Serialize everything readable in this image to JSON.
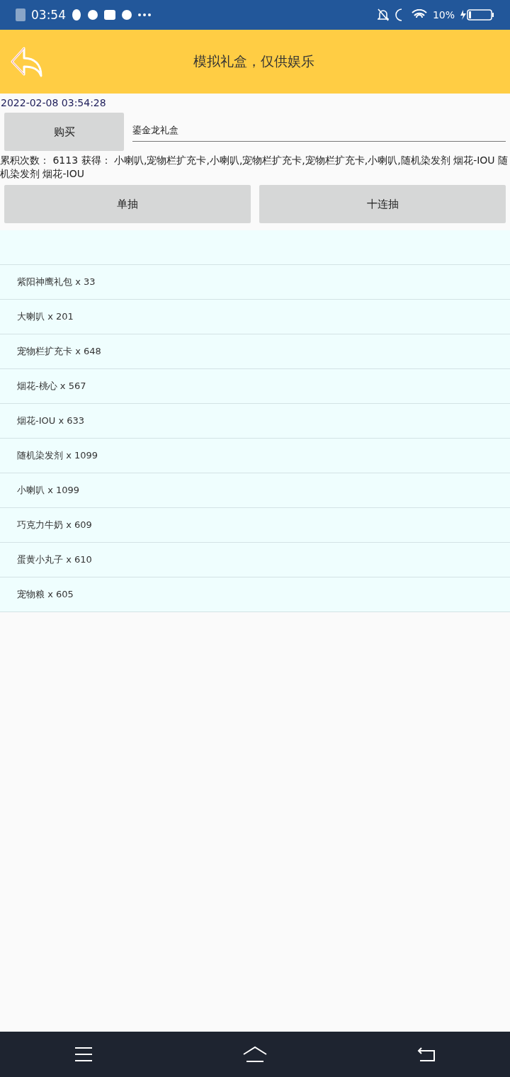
{
  "status_bar": {
    "time": "03:54",
    "battery": "10%"
  },
  "header": {
    "title": "模拟礼盒，仅供娱乐"
  },
  "timestamp": "2022-02-08 03:54:28",
  "buy_button": "购买",
  "box_field": {
    "value": "鎏金龙礼盒"
  },
  "result": "累积次数： 6113 获得： 小喇叭,宠物栏扩充卡,小喇叭,宠物栏扩充卡,宠物栏扩充卡,小喇叭,随机染发剂 烟花-IOU 随机染发剂 烟花-IOU",
  "draw_buttons": [
    "单抽",
    "十连抽"
  ],
  "items": [
    {
      "text": "紫阳神鹰礼包 x 33"
    },
    {
      "text": "大喇叭 x 201"
    },
    {
      "text": "宠物栏扩充卡 x 648"
    },
    {
      "text": "烟花-桃心 x 567"
    },
    {
      "text": "烟花-IOU x 633"
    },
    {
      "text": "随机染发剂 x 1099"
    },
    {
      "text": "小喇叭 x 1099"
    },
    {
      "text": "巧克力牛奶 x 609"
    },
    {
      "text": "蛋黄小丸子 x 610"
    },
    {
      "text": "宠物粮 x 605"
    }
  ]
}
